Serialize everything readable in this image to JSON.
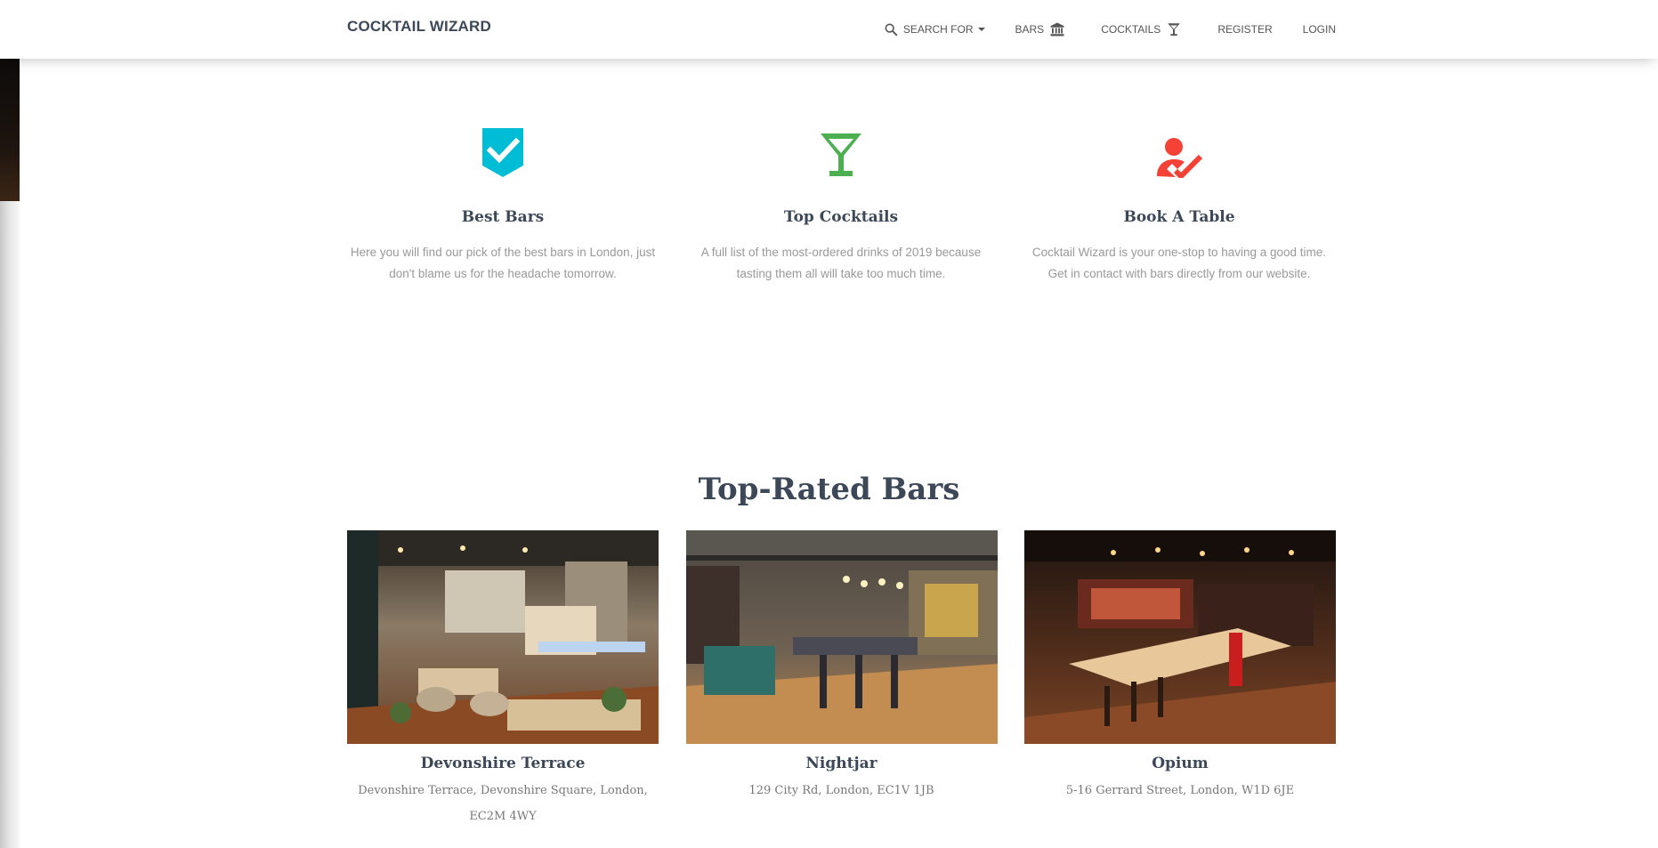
{
  "navbar": {
    "brand": "COCKTAIL WIZARD",
    "items": [
      {
        "label": "SEARCH FOR",
        "icon": "search-icon"
      },
      {
        "label": "BARS",
        "icon": "bank-icon"
      },
      {
        "label": "COCKTAILS",
        "icon": "cocktail-icon"
      },
      {
        "label": "REGISTER"
      },
      {
        "label": "LOGIN"
      }
    ]
  },
  "features": [
    {
      "icon": "verified-badge-icon",
      "color": "#00bcd4",
      "title": "Best Bars",
      "text": "Here you will find our pick of the best bars in London, just don't blame us for the headache tomorrow."
    },
    {
      "icon": "martini-glass-icon",
      "color": "#4caf50",
      "title": "Top Cocktails",
      "text": "A full list of the most-ordered drinks of 2019 because tasting them all will take too much time."
    },
    {
      "icon": "person-check-icon",
      "color": "#f44336",
      "title": "Book A Table",
      "text": "Cocktail Wizard is your one-stop to having a good time. Get in contact with bars directly from our website."
    }
  ],
  "top_rated": {
    "title": "Top-Rated Bars",
    "bars": [
      {
        "name": "Devonshire Terrace",
        "address": "Devonshire Terrace, Devonshire Square, London, EC2M 4WY"
      },
      {
        "name": "Nightjar",
        "address": "129 City Rd, London, EC1V 1JB"
      },
      {
        "name": "Opium",
        "address": "5-16 Gerrard Street, London, W1D 6JE"
      }
    ]
  }
}
